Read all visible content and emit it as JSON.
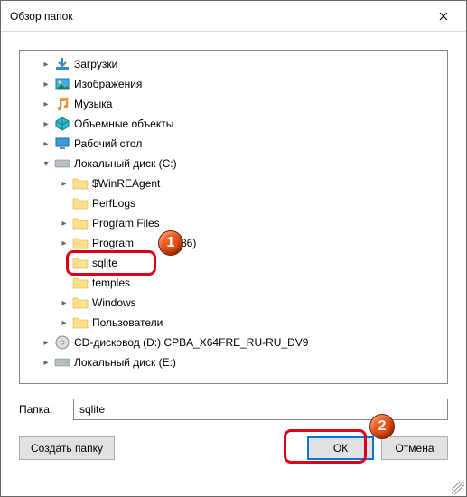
{
  "title": "Обзор папок",
  "tree": {
    "items": [
      {
        "indent": 1,
        "arrow": "right",
        "icon": "downloads",
        "label": "Загрузки"
      },
      {
        "indent": 1,
        "arrow": "right",
        "icon": "pictures",
        "label": "Изображения"
      },
      {
        "indent": 1,
        "arrow": "right",
        "icon": "music",
        "label": "Музыка"
      },
      {
        "indent": 1,
        "arrow": "right",
        "icon": "objects3d",
        "label": "Объемные объекты"
      },
      {
        "indent": 1,
        "arrow": "right",
        "icon": "desktop",
        "label": "Рабочий стол"
      },
      {
        "indent": 1,
        "arrow": "down",
        "icon": "drive",
        "label": "Локальный диск (C:)"
      },
      {
        "indent": 2,
        "arrow": "right",
        "icon": "folder",
        "label": "$WinREAgent"
      },
      {
        "indent": 2,
        "arrow": "none",
        "icon": "folder",
        "label": "PerfLogs"
      },
      {
        "indent": 2,
        "arrow": "right",
        "icon": "folder",
        "label": "Program Files"
      },
      {
        "indent": 2,
        "arrow": "right",
        "icon": "folder",
        "label": "Program",
        "suffix": "(x86)"
      },
      {
        "indent": 2,
        "arrow": "none",
        "icon": "folder",
        "label": "sqlite",
        "selected": true
      },
      {
        "indent": 2,
        "arrow": "none",
        "icon": "folder",
        "label": "temples"
      },
      {
        "indent": 2,
        "arrow": "right",
        "icon": "folder",
        "label": "Windows"
      },
      {
        "indent": 2,
        "arrow": "right",
        "icon": "folder",
        "label": "Пользователи"
      },
      {
        "indent": 1,
        "arrow": "right",
        "icon": "dvd",
        "label": "CD-дисковод (D:) CPBA_X64FRE_RU-RU_DV9"
      },
      {
        "indent": 1,
        "arrow": "right",
        "icon": "drive",
        "label": "Локальный диск (E:)"
      }
    ]
  },
  "folder_label": "Папка:",
  "folder_value": "sqlite",
  "buttons": {
    "create": "Создать папку",
    "ok": "ОК",
    "cancel": "Отмена"
  },
  "callouts": {
    "one": "1",
    "two": "2"
  }
}
